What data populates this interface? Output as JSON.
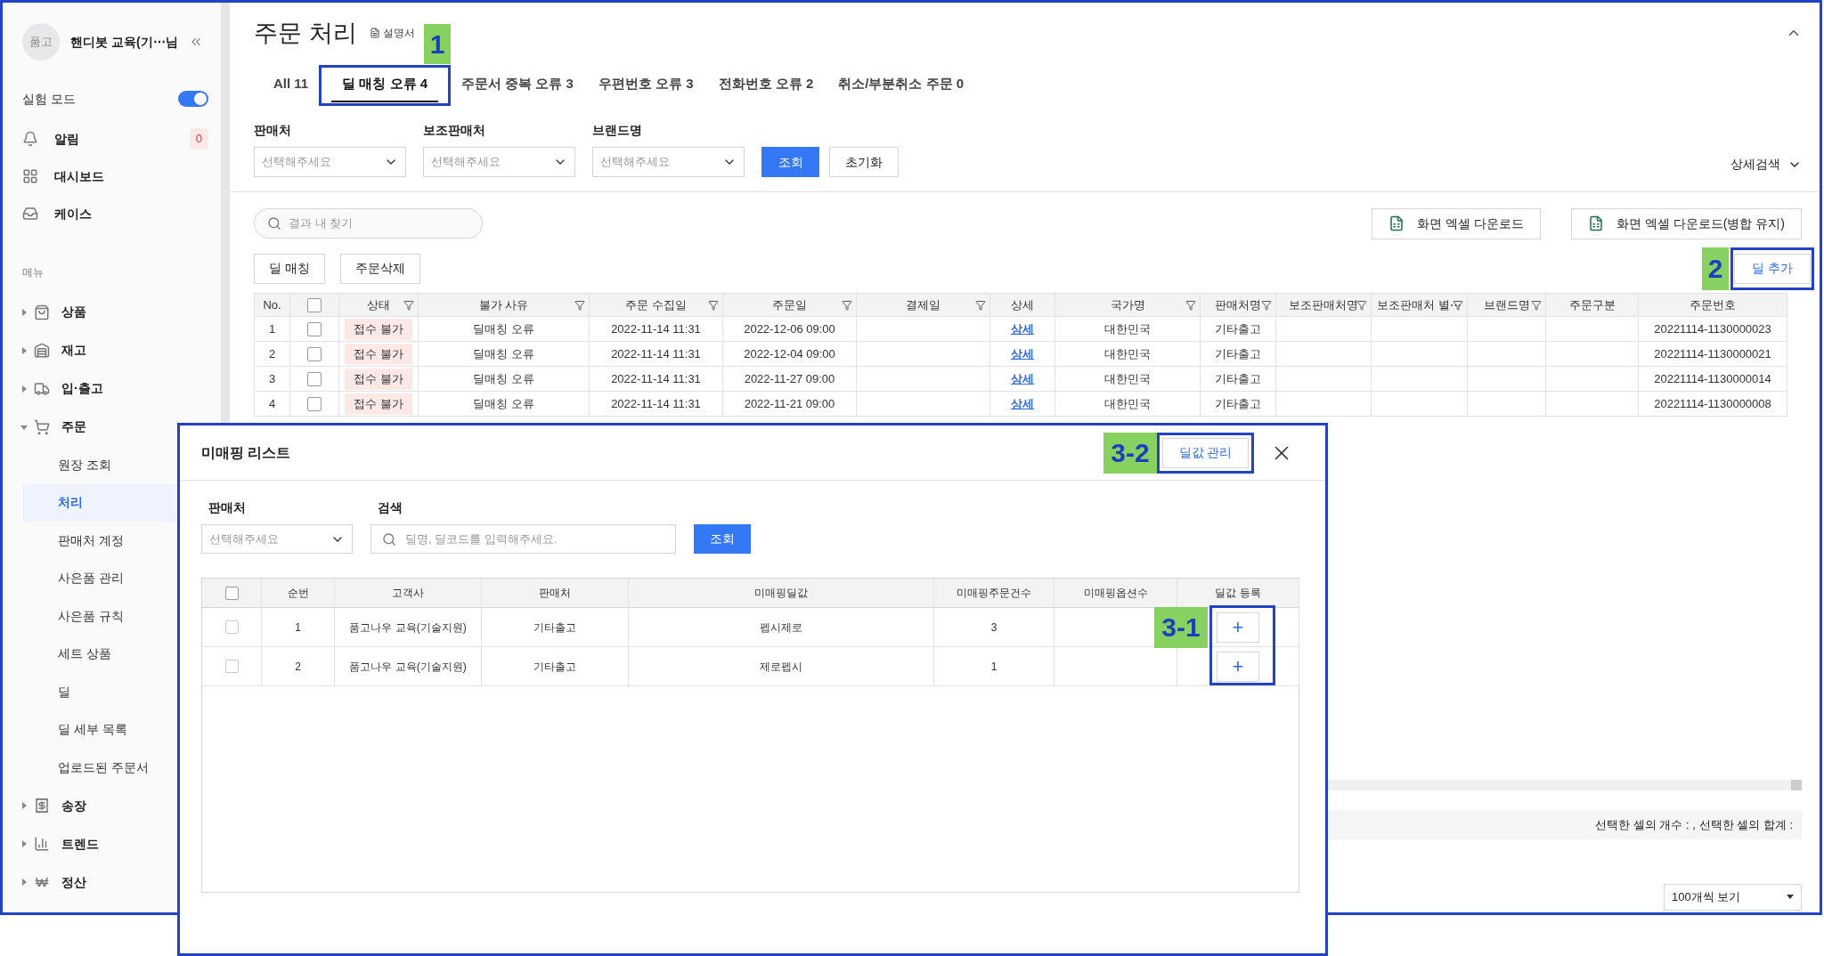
{
  "sidebar": {
    "avatar": "품고",
    "user": "핸디봇 교육(기⋯님",
    "test_mode": {
      "label": "실험 모드",
      "on": true
    },
    "top_items": [
      {
        "label": "알림",
        "badge": "0"
      },
      {
        "label": "대시보드"
      },
      {
        "label": "케이스"
      }
    ],
    "section": "메뉴",
    "menu": [
      {
        "label": "상품",
        "expanded": false
      },
      {
        "label": "재고",
        "expanded": false
      },
      {
        "label": "입·출고",
        "expanded": false
      },
      {
        "label": "주문",
        "expanded": true,
        "children": [
          {
            "label": "원장 조회",
            "selected": false
          },
          {
            "label": "처리",
            "selected": true
          },
          {
            "label": "판매처 계정",
            "selected": false
          },
          {
            "label": "사은품 관리",
            "selected": false
          },
          {
            "label": "사은품 규칙",
            "selected": false
          },
          {
            "label": "세트 상품",
            "selected": false
          },
          {
            "label": "딜",
            "selected": false
          },
          {
            "label": "딜 세부 목록",
            "selected": false
          },
          {
            "label": "업로드된 주문서",
            "selected": false
          }
        ]
      },
      {
        "label": "송장",
        "expanded": false
      },
      {
        "label": "트렌드",
        "expanded": false
      },
      {
        "label": "정산",
        "expanded": false
      }
    ]
  },
  "page": {
    "title": "주문 처리",
    "manual": "설명서"
  },
  "tabs": [
    {
      "label": "All 11",
      "selected": false
    },
    {
      "label": "딜 매칭 오류 4",
      "selected": true,
      "callout": "1"
    },
    {
      "label": "주문서 중복 오류 3",
      "selected": false
    },
    {
      "label": "우편번호 오류 3",
      "selected": false
    },
    {
      "label": "전화번호 오류 2",
      "selected": false
    },
    {
      "label": "취소/부분취소 주문 0",
      "selected": false
    }
  ],
  "filters": [
    {
      "label": "판매처",
      "placeholder": "선택해주세요"
    },
    {
      "label": "보조판매처",
      "placeholder": "선택해주세요"
    },
    {
      "label": "브랜드명",
      "placeholder": "선택해주세요"
    }
  ],
  "filter_buttons": {
    "search": "조회",
    "reset": "초기화"
  },
  "advanced_search": "상세검색",
  "result_search": {
    "placeholder": "결과 내 찾기"
  },
  "actions": [
    "딜 매칭",
    "주문삭제"
  ],
  "downloads": [
    "화면 엑셀 다운로드",
    "화면 엑셀 다운로드(병합 유지)"
  ],
  "add_deal": {
    "label": "딜 추가",
    "callout": "2"
  },
  "table": {
    "columns": [
      {
        "label": "No.",
        "filter": false
      },
      {
        "kind": "checkbox",
        "checked": false,
        "filter": false
      },
      {
        "label": "상태",
        "filter": true
      },
      {
        "label": "불가 사유",
        "filter": true
      },
      {
        "label": "주문 수집일",
        "filter": true
      },
      {
        "label": "주문일",
        "filter": true
      },
      {
        "label": "결제일",
        "filter": true
      },
      {
        "label": "상세",
        "filter": false
      },
      {
        "label": "국가명",
        "filter": true
      },
      {
        "label": "판매처명",
        "filter": true
      },
      {
        "label": "보조판매처명",
        "filter": true
      },
      {
        "label": "보조판매처 별⋯",
        "filter": true
      },
      {
        "label": "브랜드명",
        "filter": true
      },
      {
        "label": "주문구분",
        "filter": false
      },
      {
        "label": "주문번호",
        "filter": false
      }
    ],
    "rows": [
      {
        "no": "1",
        "checked": false,
        "status": "접수 불가",
        "reason": "딜매칭 오류",
        "collected": "2022-11-14 11:31",
        "ordered": "2022-12-06 09:00",
        "detail": "상세",
        "country": "대한민국",
        "seller": "기타출고",
        "order_no": "20221114-1130000023"
      },
      {
        "no": "2",
        "checked": false,
        "status": "접수 불가",
        "reason": "딜매칭 오류",
        "collected": "2022-11-14 11:31",
        "ordered": "2022-12-04 09:00",
        "detail": "상세",
        "country": "대한민국",
        "seller": "기타출고",
        "order_no": "20221114-1130000021"
      },
      {
        "no": "3",
        "checked": false,
        "status": "접수 불가",
        "reason": "딜매칭 오류",
        "collected": "2022-11-14 11:31",
        "ordered": "2022-11-27 09:00",
        "detail": "상세",
        "country": "대한민국",
        "seller": "기타출고",
        "order_no": "20221114-1130000014"
      },
      {
        "no": "4",
        "checked": false,
        "status": "접수 불가",
        "reason": "딜매칭 오류",
        "collected": "2022-11-14 11:31",
        "ordered": "2022-11-21 09:00",
        "detail": "상세",
        "country": "대한민국",
        "seller": "기타출고",
        "order_no": "20221114-1130000008"
      }
    ]
  },
  "status_bar": "선택한 셀의 개수 : , 선택한 셀의 합계 :",
  "page_size": "100개씩 보기",
  "modal": {
    "title": "미매핑 리스트",
    "manage": {
      "label": "딜값 관리",
      "callout": "3-2"
    },
    "seller": {
      "label": "판매처",
      "placeholder": "선택해주세요"
    },
    "search": {
      "label": "검색",
      "placeholder": "딜명, 딜코드를 입력해주세요."
    },
    "search_button": "조회",
    "columns": [
      {
        "kind": "checkbox",
        "checked": false
      },
      {
        "label": "순번"
      },
      {
        "label": "고객사"
      },
      {
        "label": "판매처"
      },
      {
        "label": "미매핑딜값"
      },
      {
        "label": "미매핑주문건수"
      },
      {
        "label": "미매핑옵션수"
      },
      {
        "label": "딜값 등록"
      }
    ],
    "register_callout": "3-1",
    "rows": [
      {
        "checked": false,
        "no": "1",
        "client": "품고나우 교육(기술지원)",
        "seller": "기타출고",
        "deal": "펩시제로",
        "orders": "3",
        "register": "+"
      },
      {
        "checked": false,
        "no": "2",
        "client": "품고나우 교육(기술지원)",
        "seller": "기타출고",
        "deal": "제로펩시",
        "orders": "1",
        "register": "+"
      }
    ]
  }
}
